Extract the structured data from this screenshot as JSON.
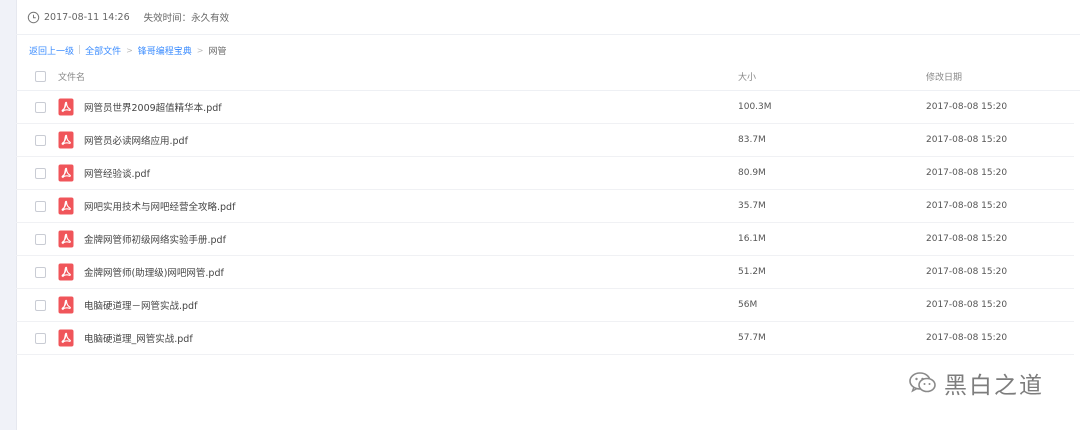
{
  "info": {
    "created": "2017-08-11 14:26",
    "expire_label": "失效时间：",
    "expire_value": "永久有效"
  },
  "breadcrumb": {
    "back": "返回上一级",
    "all_files": "全部文件",
    "folder1": "锋哥编程宝典",
    "current": "网管"
  },
  "table": {
    "headers": {
      "name": "文件名",
      "size": "大小",
      "date": "修改日期"
    },
    "rows": [
      {
        "name": "网管员世界2009超值精华本.pdf",
        "size": "100.3M",
        "date": "2017-08-08 15:20"
      },
      {
        "name": "网管员必读网络应用.pdf",
        "size": "83.7M",
        "date": "2017-08-08 15:20"
      },
      {
        "name": "网管经验谈.pdf",
        "size": "80.9M",
        "date": "2017-08-08 15:20"
      },
      {
        "name": "网吧实用技术与网吧经营全攻略.pdf",
        "size": "35.7M",
        "date": "2017-08-08 15:20"
      },
      {
        "name": "金牌网管师初级网络实验手册.pdf",
        "size": "16.1M",
        "date": "2017-08-08 15:20"
      },
      {
        "name": "金牌网管师(助理级)网吧网管.pdf",
        "size": "51.2M",
        "date": "2017-08-08 15:20"
      },
      {
        "name": "电脑硬道理－网管实战.pdf",
        "size": "56M",
        "date": "2017-08-08 15:20"
      },
      {
        "name": "电脑硬道理_网管实战.pdf",
        "size": "57.7M",
        "date": "2017-08-08 15:20"
      }
    ]
  },
  "watermark": {
    "text": "黑白之道",
    "icon": "wechat-icon"
  },
  "colors": {
    "link": "#3b8cff",
    "pdf_red": "#f0555a"
  }
}
